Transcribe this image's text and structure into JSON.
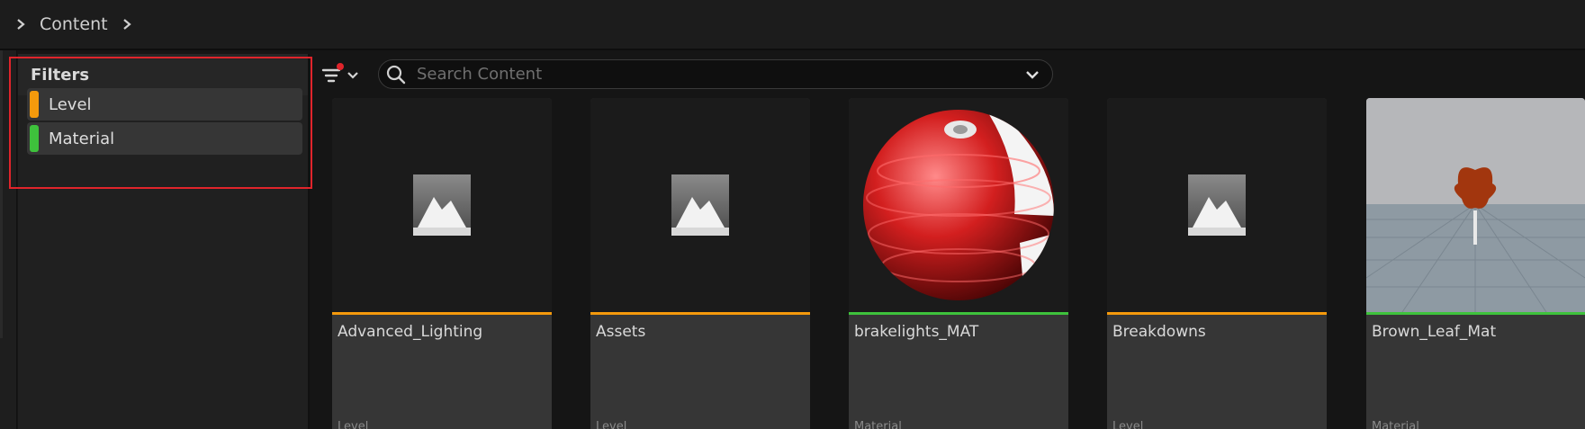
{
  "breadcrumb": {
    "root_label": "Content"
  },
  "filters": {
    "title": "Filters",
    "items": [
      {
        "label": "Level",
        "color": "#f59a0c"
      },
      {
        "label": "Material",
        "color": "#3ec23c"
      }
    ]
  },
  "search": {
    "placeholder": "Search Content",
    "value": ""
  },
  "assets": [
    {
      "name": "Advanced_Lighting",
      "type": "Level",
      "color": "#f59a0c",
      "thumbnail": "level-icon"
    },
    {
      "name": "Assets",
      "type": "Level",
      "color": "#f59a0c",
      "thumbnail": "level-icon"
    },
    {
      "name": "brakelights_MAT",
      "type": "Material",
      "color": "#3ec23c",
      "thumbnail": "material-sphere"
    },
    {
      "name": "Breakdowns",
      "type": "Level",
      "color": "#f59a0c",
      "thumbnail": "level-icon"
    },
    {
      "name": "Brown_Leaf_Mat",
      "type": "Material",
      "color": "#3ec23c",
      "thumbnail": "leaf-preview"
    }
  ]
}
